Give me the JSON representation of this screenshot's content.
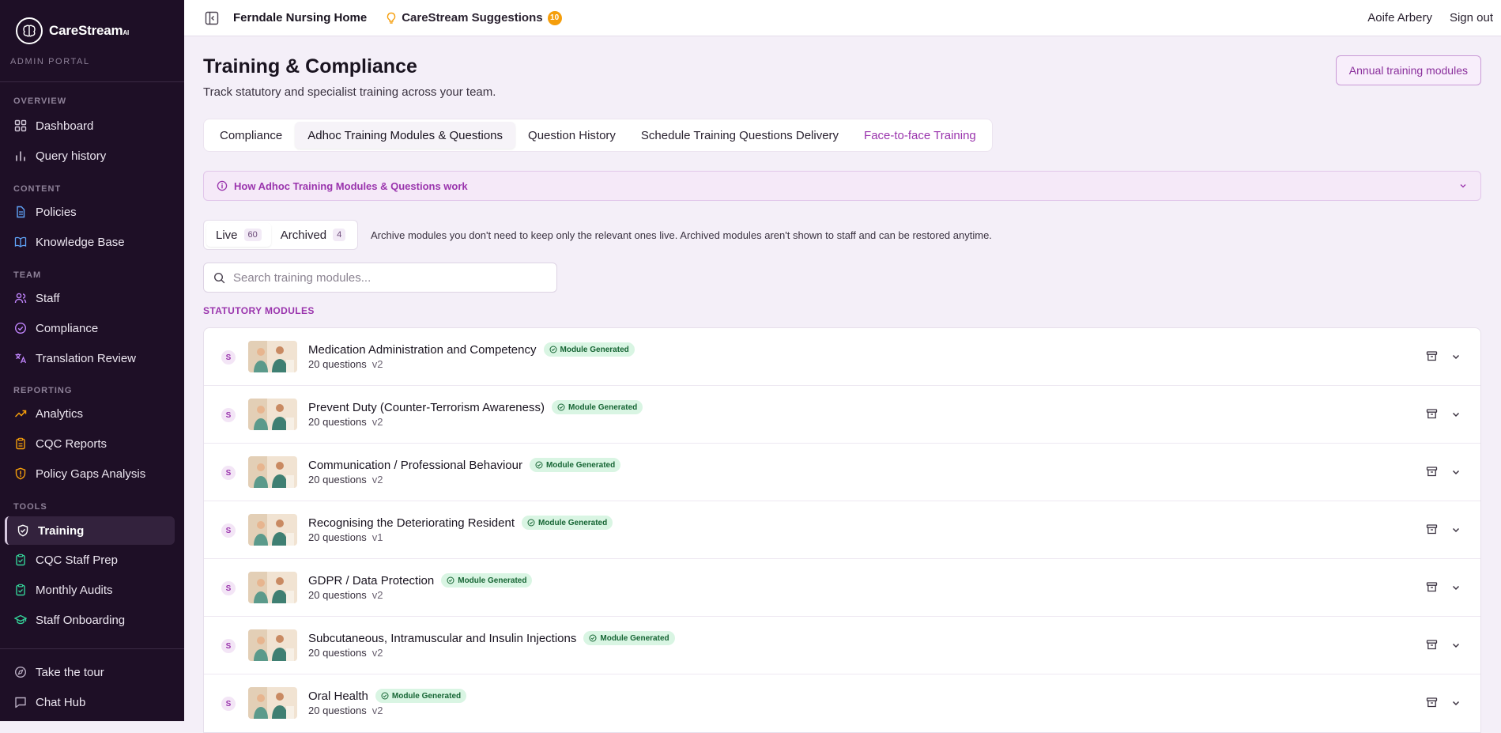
{
  "brand": {
    "name": "CareStream",
    "suffix": "AI",
    "portal": "ADMIN PORTAL"
  },
  "sidebar": {
    "sections": [
      {
        "label": "OVERVIEW",
        "items": [
          {
            "label": "Dashboard",
            "icon": "grid-icon"
          },
          {
            "label": "Query history",
            "icon": "bar-chart-icon"
          }
        ]
      },
      {
        "label": "CONTENT",
        "items": [
          {
            "label": "Policies",
            "icon": "document-icon"
          },
          {
            "label": "Knowledge Base",
            "icon": "book-icon"
          }
        ]
      },
      {
        "label": "TEAM",
        "items": [
          {
            "label": "Staff",
            "icon": "users-icon"
          },
          {
            "label": "Compliance",
            "icon": "check-circle-icon"
          },
          {
            "label": "Translation Review",
            "icon": "translate-icon"
          }
        ]
      },
      {
        "label": "REPORTING",
        "items": [
          {
            "label": "Analytics",
            "icon": "trend-icon"
          },
          {
            "label": "CQC Reports",
            "icon": "clipboard-icon"
          },
          {
            "label": "Policy Gaps Analysis",
            "icon": "shield-alert-icon"
          }
        ]
      },
      {
        "label": "TOOLS",
        "items": [
          {
            "label": "Training",
            "icon": "shield-check-icon",
            "active": true
          },
          {
            "label": "CQC Staff Prep",
            "icon": "clipboard-check-icon"
          },
          {
            "label": "Monthly Audits",
            "icon": "clipboard-list-icon"
          },
          {
            "label": "Staff Onboarding",
            "icon": "graduation-cap-icon"
          }
        ]
      }
    ],
    "footer": [
      {
        "label": "Take the tour",
        "icon": "compass-icon"
      },
      {
        "label": "Chat Hub",
        "icon": "chat-icon"
      }
    ]
  },
  "topbar": {
    "org": "Ferndale Nursing Home",
    "suggestions_label": "CareStream Suggestions",
    "suggestions_count": "10",
    "user": "Aoife Arbery",
    "signout": "Sign out"
  },
  "page": {
    "title": "Training & Compliance",
    "subtitle": "Track statutory and specialist training across your team.",
    "annual_button": "Annual training modules",
    "tabs": [
      "Compliance",
      "Adhoc Training Modules & Questions",
      "Question History",
      "Schedule Training Questions Delivery",
      "Face-to-face Training"
    ],
    "howto": "How Adhoc Training Modules & Questions work",
    "live_label": "Live",
    "live_count": "60",
    "archived_label": "Archived",
    "archived_count": "4",
    "archive_note": "Archive modules you don't need to keep only the relevant ones live. Archived modules aren't shown to staff and can be restored anytime.",
    "search_placeholder": "Search training modules...",
    "group_label": "STATUTORY MODULES",
    "status_badge": "Module Generated",
    "type_letter": "S"
  },
  "modules": [
    {
      "title": "Medication Administration and Competency",
      "questions": "20 questions",
      "version": "v2"
    },
    {
      "title": "Prevent Duty (Counter-Terrorism Awareness)",
      "questions": "20 questions",
      "version": "v2"
    },
    {
      "title": "Communication / Professional Behaviour",
      "questions": "20 questions",
      "version": "v2"
    },
    {
      "title": "Recognising the Deteriorating Resident",
      "questions": "20 questions",
      "version": "v1"
    },
    {
      "title": "GDPR / Data Protection",
      "questions": "20 questions",
      "version": "v2"
    },
    {
      "title": "Subcutaneous, Intramuscular and Insulin Injections",
      "questions": "20 questions",
      "version": "v2"
    },
    {
      "title": "Oral Health",
      "questions": "20 questions",
      "version": "v2"
    }
  ],
  "colors": {
    "sidebar_bg": "#1e0f26",
    "accent": "#9a34ad",
    "badge_green_bg": "#d9f5e3",
    "badge_green_text": "#166534",
    "suggest_badge": "#f59e0b"
  }
}
